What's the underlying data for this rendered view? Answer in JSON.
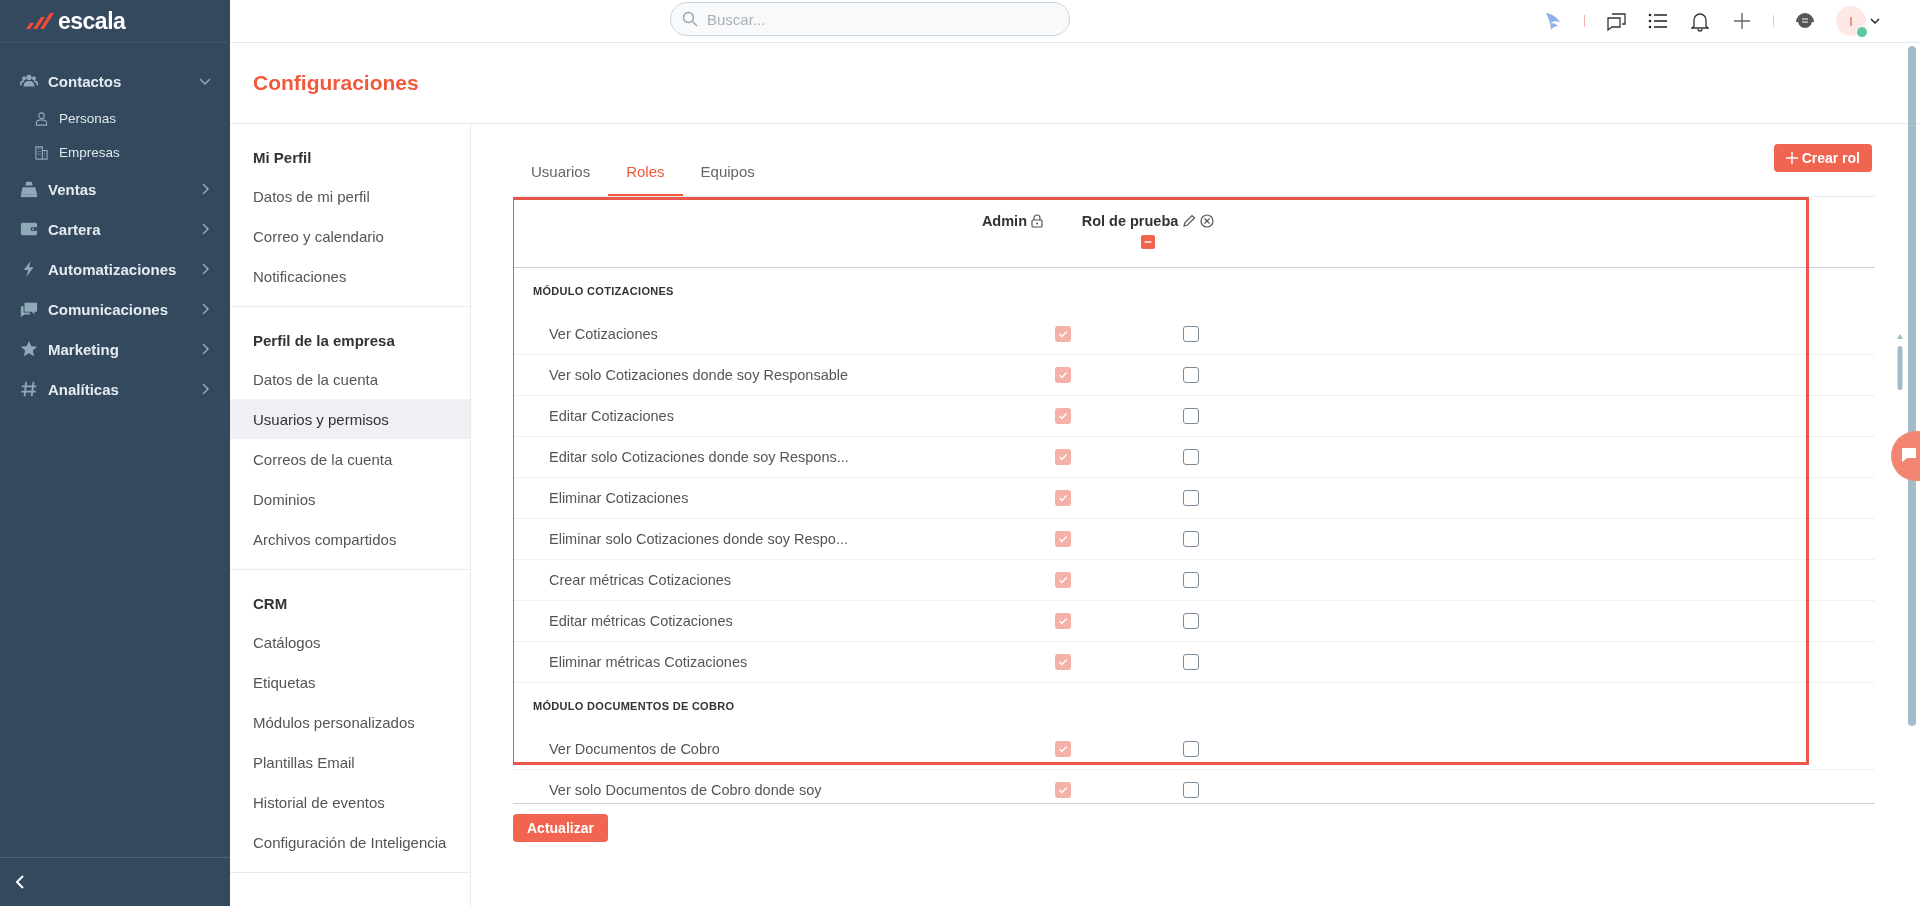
{
  "brand": {
    "name": "escala"
  },
  "sidebar": {
    "items": [
      {
        "label": "Contactos",
        "expanded": true,
        "children": [
          {
            "label": "Personas"
          },
          {
            "label": "Empresas"
          }
        ]
      },
      {
        "label": "Ventas",
        "expanded": false
      },
      {
        "label": "Cartera",
        "expanded": false
      },
      {
        "label": "Automatizaciones",
        "expanded": false
      },
      {
        "label": "Comunicaciones",
        "expanded": false
      },
      {
        "label": "Marketing",
        "expanded": false
      },
      {
        "label": "Analíticas",
        "expanded": false
      }
    ]
  },
  "topbar": {
    "search": {
      "placeholder": "Buscar..."
    },
    "avatar": {
      "initial": "I",
      "online": true
    }
  },
  "page": {
    "title": "Configuraciones"
  },
  "settings_menu": [
    {
      "heading": "Mi Perfil",
      "items": [
        {
          "label": "Datos de mi perfil",
          "selected": false
        },
        {
          "label": "Correo y calendario",
          "selected": false
        },
        {
          "label": "Notificaciones",
          "selected": false
        }
      ]
    },
    {
      "heading": "Perfil de la empresa",
      "items": [
        {
          "label": "Datos de la cuenta",
          "selected": false
        },
        {
          "label": "Usuarios y permisos",
          "selected": true
        },
        {
          "label": "Correos de la cuenta",
          "selected": false
        },
        {
          "label": "Dominios",
          "selected": false
        },
        {
          "label": "Archivos compartidos",
          "selected": false
        }
      ]
    },
    {
      "heading": "CRM",
      "items": [
        {
          "label": "Catálogos",
          "selected": false
        },
        {
          "label": "Etiquetas",
          "selected": false
        },
        {
          "label": "Módulos personalizados",
          "selected": false
        },
        {
          "label": "Plantillas Email",
          "selected": false
        },
        {
          "label": "Historial de eventos",
          "selected": false
        },
        {
          "label": "Configuración de Inteligencia",
          "selected": false
        }
      ]
    }
  ],
  "tabs": [
    {
      "label": "Usuarios",
      "selected": false
    },
    {
      "label": "Roles",
      "selected": true
    },
    {
      "label": "Equipos",
      "selected": false
    }
  ],
  "create_button": {
    "label": "Crear rol"
  },
  "roles": [
    {
      "name": "Admin",
      "kind": "locked"
    },
    {
      "name": "Rol de prueba",
      "kind": "editable"
    }
  ],
  "sections": [
    {
      "title": "MÓDULO COTIZACIONES",
      "rows": [
        {
          "label": "Ver Cotizaciones",
          "permissions": [
            {
              "checked": true,
              "disabled": true
            },
            {
              "checked": false,
              "disabled": false
            }
          ]
        },
        {
          "label": "Ver solo Cotizaciones donde soy Responsable",
          "permissions": [
            {
              "checked": true,
              "disabled": true
            },
            {
              "checked": false,
              "disabled": false
            }
          ]
        },
        {
          "label": "Editar Cotizaciones",
          "permissions": [
            {
              "checked": true,
              "disabled": true
            },
            {
              "checked": false,
              "disabled": false
            }
          ]
        },
        {
          "label": "Editar solo Cotizaciones donde soy Respons...",
          "permissions": [
            {
              "checked": true,
              "disabled": true
            },
            {
              "checked": false,
              "disabled": false
            }
          ]
        },
        {
          "label": "Eliminar Cotizaciones",
          "permissions": [
            {
              "checked": true,
              "disabled": true
            },
            {
              "checked": false,
              "disabled": false
            }
          ]
        },
        {
          "label": "Eliminar solo Cotizaciones donde soy Respo...",
          "permissions": [
            {
              "checked": true,
              "disabled": true
            },
            {
              "checked": false,
              "disabled": false
            }
          ]
        },
        {
          "label": "Crear métricas Cotizaciones",
          "permissions": [
            {
              "checked": true,
              "disabled": true
            },
            {
              "checked": false,
              "disabled": false
            }
          ]
        },
        {
          "label": "Editar métricas Cotizaciones",
          "permissions": [
            {
              "checked": true,
              "disabled": true
            },
            {
              "checked": false,
              "disabled": false
            }
          ]
        },
        {
          "label": "Eliminar métricas Cotizaciones",
          "permissions": [
            {
              "checked": true,
              "disabled": true
            },
            {
              "checked": false,
              "disabled": false
            }
          ]
        }
      ]
    },
    {
      "title": "MÓDULO DOCUMENTOS DE COBRO",
      "rows": [
        {
          "label": "Ver Documentos de Cobro",
          "permissions": [
            {
              "checked": true,
              "disabled": true
            },
            {
              "checked": false,
              "disabled": false
            }
          ]
        },
        {
          "label": "Ver solo Documentos de Cobro donde soy",
          "permissions": [
            {
              "checked": true,
              "disabled": true
            },
            {
              "checked": false,
              "disabled": false
            }
          ]
        }
      ]
    }
  ],
  "update_button": {
    "label": "Actualizar"
  }
}
